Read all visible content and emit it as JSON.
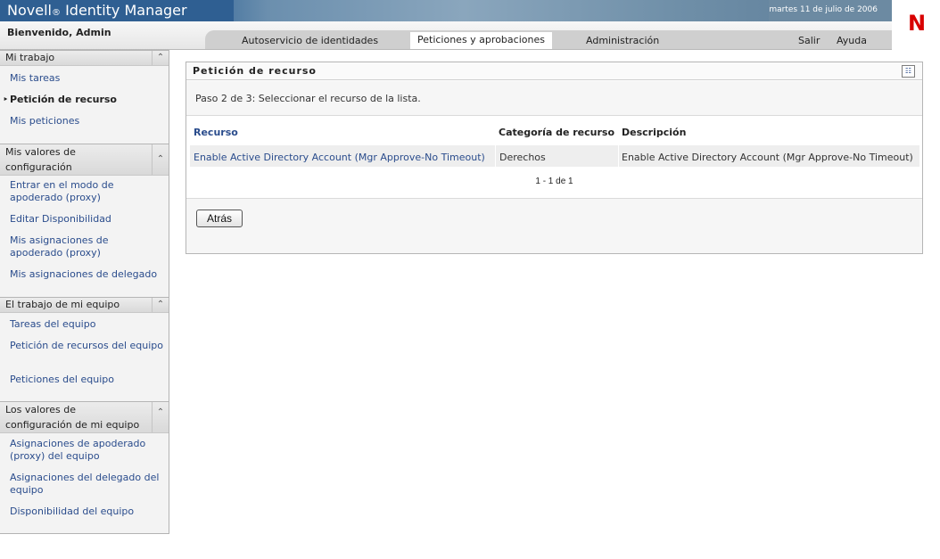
{
  "header": {
    "brand": "Novell",
    "brand_mark": "®",
    "product": "Identity Manager",
    "date": "martes 11 de julio de 2006",
    "logo_letter": "N",
    "welcome": "Bienvenido, Admin"
  },
  "tabs": [
    {
      "label": "Autoservicio de identidades",
      "active": false
    },
    {
      "label": "Peticiones y aprobaciones",
      "active": true
    },
    {
      "label": "Administración",
      "active": false
    }
  ],
  "utility": {
    "logout": "Salir",
    "help": "Ayuda"
  },
  "sidebar": {
    "sections": [
      {
        "title": "Mi trabajo",
        "items": [
          "Mis tareas",
          "Petición de recurso",
          "Mis peticiones"
        ],
        "current": "Petición de recurso"
      },
      {
        "title_line1": "Mis valores de",
        "title_line2": "configuración",
        "items": [
          "Entrar en el modo de apoderado (proxy)",
          "Editar Disponibilidad",
          "Mis asignaciones de apoderado (proxy)",
          "Mis asignaciones de delegado"
        ]
      },
      {
        "title": "El trabajo de mi equipo",
        "items": [
          "Tareas del equipo",
          "Petición de recursos del equipo",
          "Peticiones del equipo"
        ]
      },
      {
        "title_line1": "Los valores de",
        "title_line2": "configuración de mi equipo",
        "items": [
          "Asignaciones de apoderado (proxy) del equipo",
          "Asignaciones del delegado del equipo",
          "Disponibilidad del equipo"
        ]
      }
    ]
  },
  "panel": {
    "title": "Petición de recurso",
    "step": "Paso 2 de 3: Seleccionar el recurso de la lista.",
    "columns": [
      "Recurso",
      "Categoría de recurso",
      "Descripción"
    ],
    "rows": [
      {
        "resource": "Enable Active Directory Account (Mgr Approve-No Timeout)",
        "category": "Derechos",
        "description": "Enable Active Directory Account (Mgr Approve-No Timeout)"
      }
    ],
    "paging": "1 - 1 de 1",
    "back_label": "Atrás"
  },
  "colors": {
    "accent": "#2a4c8c",
    "brand_bg": "#2f5f92",
    "logo": "#d80000"
  }
}
